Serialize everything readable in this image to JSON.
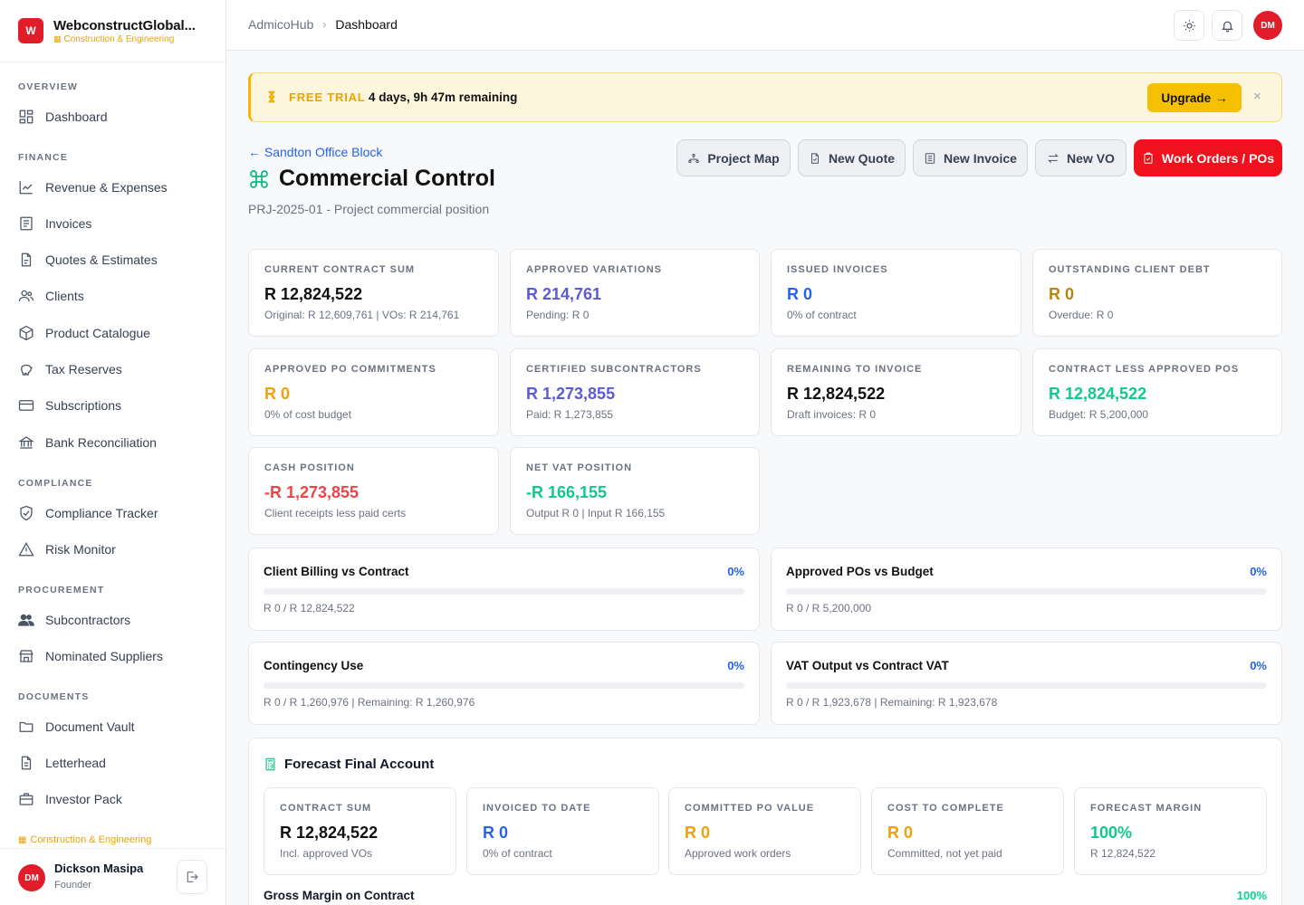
{
  "brand": {
    "logo": "W",
    "name": "WebconstructGlobal...",
    "sub": "Construction & Engineering"
  },
  "nav": [
    {
      "section": "OVERVIEW",
      "items": [
        {
          "label": "Dashboard",
          "icon": "dashboard-icon"
        }
      ]
    },
    {
      "section": "FINANCE",
      "items": [
        {
          "label": "Revenue & Expenses",
          "icon": "chart-line-icon"
        },
        {
          "label": "Invoices",
          "icon": "invoice-icon"
        },
        {
          "label": "Quotes & Estimates",
          "icon": "quote-icon"
        },
        {
          "label": "Clients",
          "icon": "users-icon"
        },
        {
          "label": "Product Catalogue",
          "icon": "package-icon"
        },
        {
          "label": "Tax Reserves",
          "icon": "piggy-bank-icon"
        },
        {
          "label": "Subscriptions",
          "icon": "credit-card-icon"
        },
        {
          "label": "Bank Reconciliation",
          "icon": "bank-icon"
        }
      ]
    },
    {
      "section": "COMPLIANCE",
      "items": [
        {
          "label": "Compliance Tracker",
          "icon": "shield-check-icon"
        },
        {
          "label": "Risk Monitor",
          "icon": "warning-icon"
        }
      ]
    },
    {
      "section": "PROCUREMENT",
      "items": [
        {
          "label": "Subcontractors",
          "icon": "people-icon"
        },
        {
          "label": "Nominated Suppliers",
          "icon": "store-icon"
        }
      ]
    },
    {
      "section": "DOCUMENTS",
      "items": [
        {
          "label": "Document Vault",
          "icon": "folder-icon"
        },
        {
          "label": "Letterhead",
          "icon": "file-icon"
        },
        {
          "label": "Investor Pack",
          "icon": "briefcase-icon"
        }
      ]
    }
  ],
  "sidebar_footer": {
    "tag": "Construction & Engineering",
    "user_initials": "DM",
    "user_name": "Dickson Masipa",
    "user_role": "Founder"
  },
  "breadcrumb": {
    "root": "AdmicoHub",
    "current": "Dashboard"
  },
  "topbar": {
    "avatar": "DM"
  },
  "trial": {
    "tag": "FREE TRIAL",
    "text": "4 days, 9h 47m remaining",
    "upgrade": "Upgrade"
  },
  "page": {
    "back": "Sandton Office Block",
    "title": "Commercial Control",
    "subtitle": "PRJ-2025-01 - Project commercial position"
  },
  "actions": [
    {
      "label": "Project Map",
      "icon": "map-icon"
    },
    {
      "label": "New Quote",
      "icon": "quote-icon"
    },
    {
      "label": "New Invoice",
      "icon": "invoice-icon"
    },
    {
      "label": "New VO",
      "icon": "swap-icon"
    },
    {
      "label": "Work Orders / POs",
      "icon": "clipboard-icon"
    }
  ],
  "kpis": [
    {
      "label": "CURRENT CONTRACT SUM",
      "value": "R 12,824,522",
      "sub": "Original: R 12,609,761 | VOs: R 214,761",
      "color": "#111111"
    },
    {
      "label": "APPROVED VARIATIONS",
      "value": "R 214,761",
      "sub": "Pending: R 0",
      "color": "#5b5bd6"
    },
    {
      "label": "ISSUED INVOICES",
      "value": "R 0",
      "sub": "0% of contract",
      "color": "#2563eb"
    },
    {
      "label": "OUTSTANDING CLIENT DEBT",
      "value": "R 0",
      "sub": "Overdue: R 0",
      "color": "#b8860b"
    },
    {
      "label": "APPROVED PO COMMITMENTS",
      "value": "R 0",
      "sub": "0% of cost budget",
      "color": "#f59e0b"
    },
    {
      "label": "CERTIFIED SUBCONTRACTORS",
      "value": "R 1,273,855",
      "sub": "Paid: R 1,273,855",
      "color": "#5b5bd6"
    },
    {
      "label": "REMAINING TO INVOICE",
      "value": "R 12,824,522",
      "sub": "Draft invoices: R 0",
      "color": "#111111"
    },
    {
      "label": "CONTRACT LESS APPROVED POS",
      "value": "R 12,824,522",
      "sub": "Budget: R 5,200,000",
      "color": "#10c98a"
    },
    {
      "label": "CASH POSITION",
      "value": "-R 1,273,855",
      "sub": "Client receipts less paid certs",
      "color": "#ef4444"
    },
    {
      "label": "NET VAT POSITION",
      "value": "-R 166,155",
      "sub": "Output R 0 | Input R 166,155",
      "color": "#10c98a"
    }
  ],
  "progress": [
    {
      "title": "Client Billing vs Contract",
      "pct": "0%",
      "fill": 0,
      "note": "R 0 / R 12,824,522"
    },
    {
      "title": "Approved POs vs Budget",
      "pct": "0%",
      "fill": 0,
      "note": "R 0 / R 5,200,000"
    },
    {
      "title": "Contingency Use",
      "pct": "0%",
      "fill": 0,
      "note": "R 0 / R 1,260,976 | Remaining: R 1,260,976"
    },
    {
      "title": "VAT Output vs Contract VAT",
      "pct": "0%",
      "fill": 0,
      "note": "R 0 / R 1,923,678 | Remaining: R 1,923,678"
    }
  ],
  "forecast": {
    "title": "Forecast Final Account",
    "cards": [
      {
        "label": "CONTRACT SUM",
        "value": "R 12,824,522",
        "sub": "Incl. approved VOs",
        "color": "#111111"
      },
      {
        "label": "INVOICED TO DATE",
        "value": "R 0",
        "sub": "0% of contract",
        "color": "#2563eb"
      },
      {
        "label": "COMMITTED PO VALUE",
        "value": "R 0",
        "sub": "Approved work orders",
        "color": "#f59e0b"
      },
      {
        "label": "COST TO COMPLETE",
        "value": "R 0",
        "sub": "Committed, not yet paid",
        "color": "#f59e0b"
      },
      {
        "label": "FORECAST MARGIN",
        "value": "100%",
        "sub": "R 12,824,522",
        "color": "#10c98a"
      }
    ],
    "gross_margin_label": "Gross Margin on Contract",
    "gross_margin_pct": "100%"
  }
}
